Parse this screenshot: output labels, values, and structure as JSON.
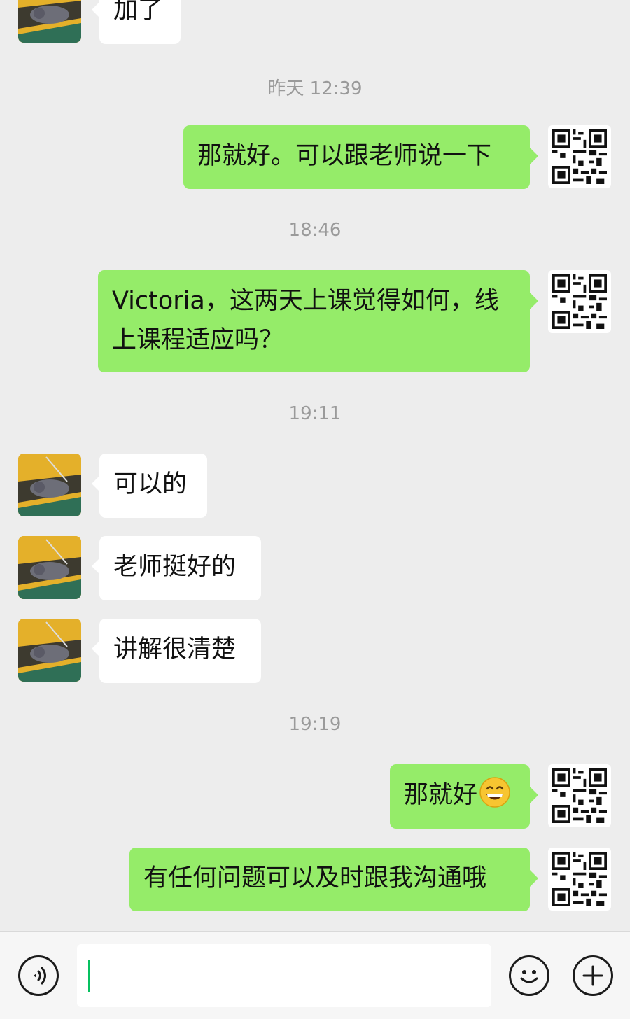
{
  "messages": {
    "m0": "加了",
    "m1": "那就好。可以跟老师说一下",
    "m2": "Victoria，这两天上课觉得如何，线上课程适应吗？",
    "m3": "可以的",
    "m4": "老师挺好的",
    "m5": "讲解很清楚",
    "m6": "那就好",
    "m7": "有任何问题可以及时跟我沟通哦"
  },
  "timestamps": {
    "t1": "昨天 12:39",
    "t2": "18:46",
    "t3": "19:11",
    "t4": "19:19"
  },
  "input": {
    "value": "",
    "placeholder": ""
  },
  "colors": {
    "background": "#ededed",
    "outgoing_bubble": "#95ec69",
    "incoming_bubble": "#ffffff",
    "caret": "#07c160"
  },
  "icons": {
    "voice": "voice-icon",
    "emoji": "emoji-icon",
    "plus": "plus-icon",
    "grin": "grinning-emoji"
  }
}
